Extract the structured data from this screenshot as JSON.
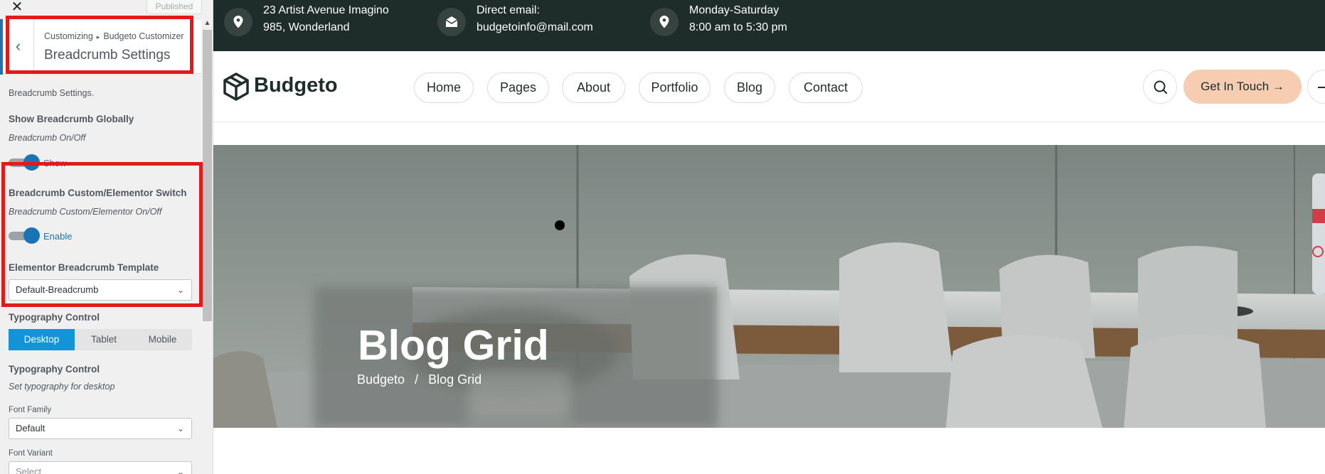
{
  "customizer": {
    "close_icon": "close-icon",
    "published_label": "Published",
    "breadcrumb_path": [
      "Customizing",
      "Budgeto Customizer"
    ],
    "section_title": "Breadcrumb Settings",
    "section_description": "Breadcrumb Settings.",
    "controls": {
      "show_breadcrumb": {
        "label": "Show Breadcrumb Globally",
        "description": "Breadcrumb On/Off",
        "toggle_state": "Show"
      },
      "custom_switch": {
        "label": "Breadcrumb Custom/Elementor Switch",
        "description": "Breadcrumb Custom/Elementor On/Off",
        "toggle_state": "Enable"
      },
      "template": {
        "label": "Elementor Breadcrumb Template",
        "value": "Default-Breadcrumb"
      },
      "typography_heading": "Typography Control",
      "device_tabs": [
        "Desktop",
        "Tablet",
        "Mobile"
      ],
      "active_device": "Desktop",
      "typography": {
        "label": "Typography Control",
        "description": "Set typography for desktop"
      },
      "font_family": {
        "label": "Font Family",
        "value": "Default"
      },
      "font_variant": {
        "label": "Font Variant",
        "value": "Select"
      }
    }
  },
  "site": {
    "topbar": [
      {
        "icon": "map-pin-icon",
        "line1": "23 Artist Avenue Imagino",
        "line2": "985, Wonderland"
      },
      {
        "icon": "mail-icon",
        "line1": "Direct email:",
        "line2": "budgetoinfo@mail.com"
      },
      {
        "icon": "map-pin-icon",
        "line1": "Monday-Saturday",
        "line2": "8:00 am to 5:30 pm"
      }
    ],
    "brand": "Budgeto",
    "nav": [
      "Home",
      "Pages",
      "About",
      "Portfolio",
      "Blog",
      "Contact"
    ],
    "cta_label": "Get In Touch",
    "hero": {
      "title": "Blog Grid",
      "breadcrumb": [
        "Budgeto",
        "Blog Grid"
      ],
      "separator": "/"
    }
  },
  "colors": {
    "accent": "#1a73b3",
    "tab_active": "#1394d6",
    "topbar_bg": "#1f2d2a",
    "cta_bg": "#f6cdb0",
    "highlight": "#e31a1a"
  }
}
